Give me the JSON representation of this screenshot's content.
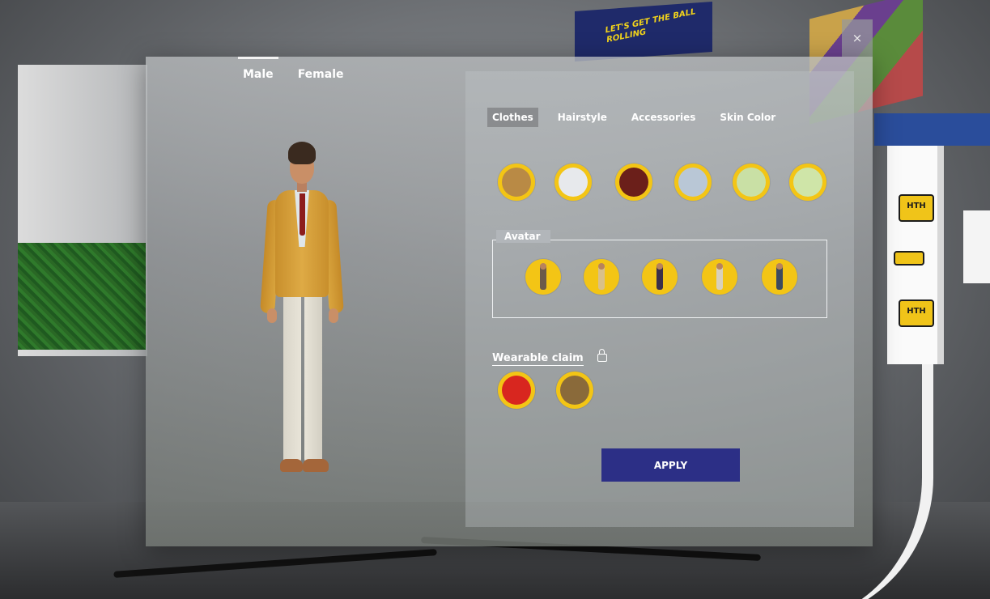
{
  "gender_tabs": [
    {
      "label": "Male",
      "active": true
    },
    {
      "label": "Female",
      "active": false
    }
  ],
  "category_tabs": [
    {
      "label": "Clothes",
      "active": true
    },
    {
      "label": "Hairstyle",
      "active": false
    },
    {
      "label": "Accessories",
      "active": false
    },
    {
      "label": "Skin Color",
      "active": false
    }
  ],
  "clothes_options": [
    {
      "name": "jacket-tie",
      "color": "#b98a45"
    },
    {
      "name": "white-tee",
      "color": "#e7e9ec"
    },
    {
      "name": "maroon-jacket",
      "color": "#6b1f1a"
    },
    {
      "name": "light-blue-tee",
      "color": "#b9c7d6"
    },
    {
      "name": "mint-tee",
      "color": "#c9e0a5"
    },
    {
      "name": "lime-tee",
      "color": "#cfe5a8"
    }
  ],
  "avatar_section": {
    "title": "Avatar",
    "options": [
      {
        "name": "avatar-1",
        "color": "#6b5a4a"
      },
      {
        "name": "avatar-2",
        "color": "#d9c089"
      },
      {
        "name": "avatar-3",
        "color": "#3a2f4a"
      },
      {
        "name": "avatar-4",
        "color": "#d8d0bd"
      },
      {
        "name": "avatar-5",
        "color": "#3d4a5f"
      }
    ]
  },
  "wearable": {
    "title": "Wearable claim",
    "locked": true,
    "options": [
      {
        "name": "red-tshirt",
        "color": "#d8261f"
      },
      {
        "name": "bag",
        "color": "#8a6a3a"
      }
    ]
  },
  "apply_label": "APPLY",
  "close_label": "×",
  "banner_text": "LET'S GET THE BALL ROLLING",
  "booth_logo": "HTH",
  "colors": {
    "accent_yellow": "#f3c515",
    "apply_blue": "#2c2f86"
  }
}
